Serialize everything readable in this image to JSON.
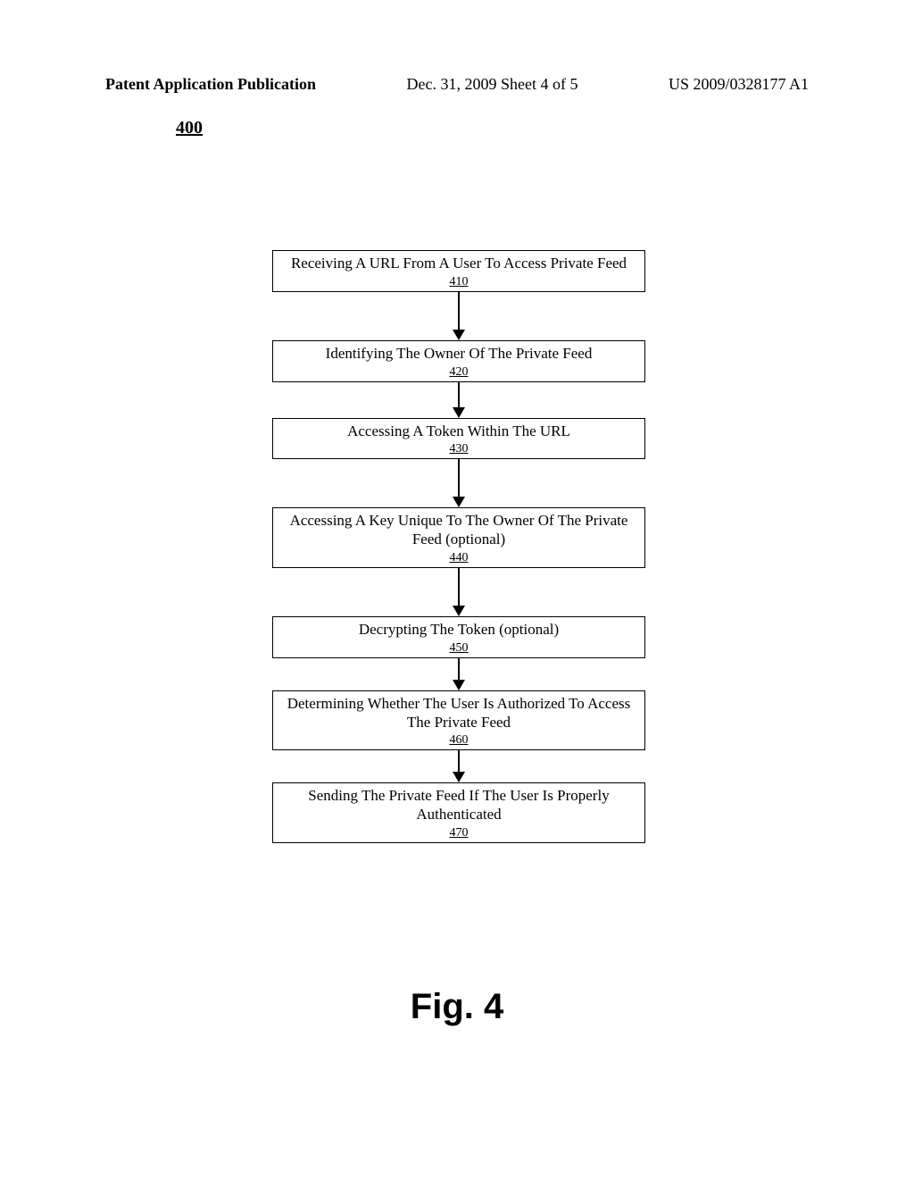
{
  "header": {
    "left": "Patent Application Publication",
    "center": "Dec. 31, 2009  Sheet 4 of 5",
    "right": "US 2009/0328177 A1"
  },
  "figure_number": "400",
  "steps": [
    {
      "text": "Receiving A URL From A User To Access Private Feed",
      "ref": "410"
    },
    {
      "text": "Identifying The Owner Of The Private Feed",
      "ref": "420"
    },
    {
      "text": "Accessing A Token Within The URL",
      "ref": "430"
    },
    {
      "text": "Accessing A Key Unique To The Owner Of The Private Feed (optional)",
      "ref": "440"
    },
    {
      "text": "Decrypting The Token (optional)",
      "ref": "450"
    },
    {
      "text": "Determining Whether The User Is Authorized To Access The Private Feed",
      "ref": "460"
    },
    {
      "text": "Sending The Private Feed If The User Is Properly Authenticated",
      "ref": "470"
    }
  ],
  "figure_label": "Fig. 4"
}
